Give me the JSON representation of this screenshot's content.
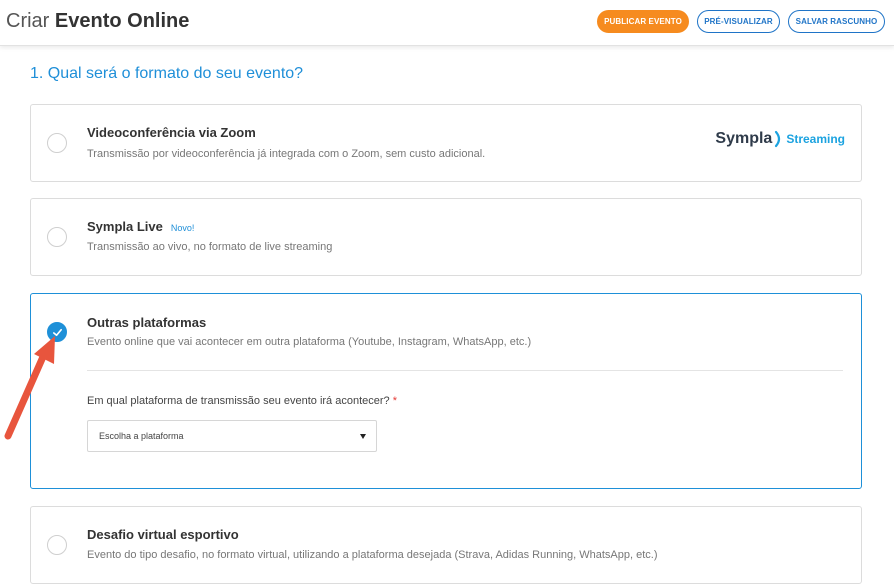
{
  "header": {
    "title_light": "Criar",
    "title_bold": "Evento Online",
    "buttons": {
      "publish": "PUBLICAR EVENTO",
      "preview": "PRÉ-VISUALIZAR",
      "draft": "SALVAR RASCUNHO"
    }
  },
  "colors": {
    "accent": "#1e90d8",
    "primary_button": "#f68b1f",
    "secondary_button": "#1f74c7",
    "annotation_arrow": "#e8553d"
  },
  "section": {
    "title": "1. Qual será o formato do seu evento?"
  },
  "options": [
    {
      "title": "Videoconferência via Zoom",
      "description": "Transmissão por videoconferência já integrada com o Zoom, sem custo adicional.",
      "logo": {
        "brand": "Sympla",
        "product": "Streaming"
      },
      "selected": false
    },
    {
      "title": "Sympla Live",
      "badge": "Novo!",
      "description": "Transmissão ao vivo, no formato de live streaming",
      "selected": false
    },
    {
      "title": "Outras plataformas",
      "description": "Evento online que vai acontecer em outra plataforma (Youtube, Instagram, WhatsApp, etc.)",
      "selected": true,
      "field": {
        "label": "Em qual plataforma de transmissão seu evento irá acontecer?",
        "required_mark": "*",
        "select_value": "Escolha a plataforma"
      }
    },
    {
      "title": "Desafio virtual esportivo",
      "description": "Evento do tipo desafio, no formato virtual, utilizando a plataforma desejada (Strava, Adidas Running, WhatsApp, etc.)",
      "selected": false
    }
  ],
  "icons": {
    "check": "check-icon",
    "caret": "caret-down-icon",
    "annotation": "red-arrow-icon"
  }
}
